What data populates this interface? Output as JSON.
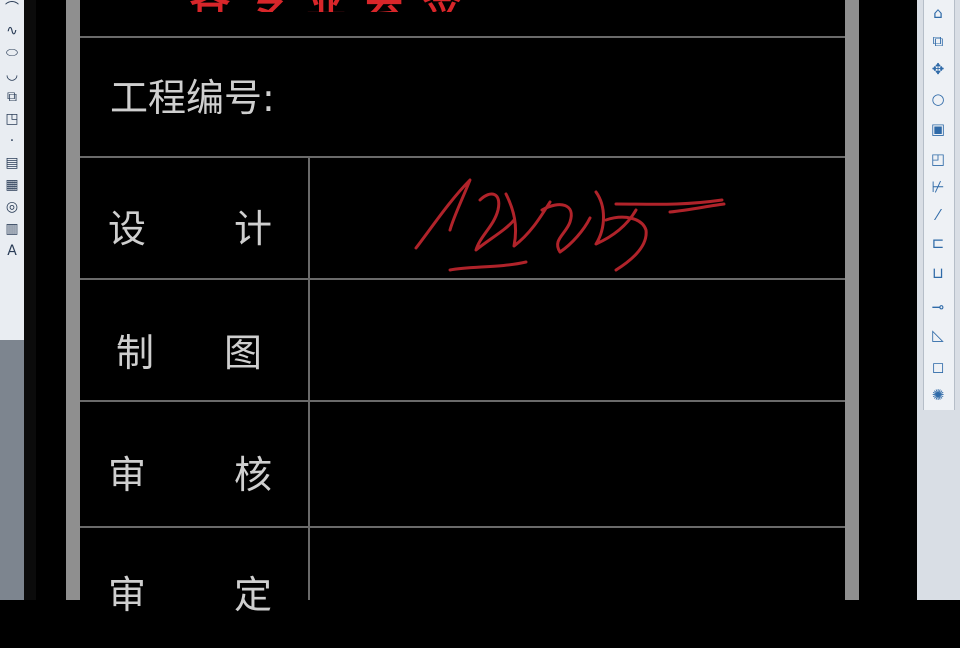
{
  "title_block": {
    "header": "各专业会签",
    "project_number_label": "工程编号:",
    "rows": [
      {
        "c1": "设",
        "c2": "计"
      },
      {
        "c1": "制",
        "c2": "图"
      },
      {
        "c1": "审",
        "c2": "核"
      },
      {
        "c1": "审",
        "c2": "定"
      }
    ]
  },
  "colors": {
    "table_line": "#6a6a6a",
    "text": "#cfcfcf",
    "header_red": "#d8262a",
    "signature_red": "#b0232a"
  },
  "left_toolbar_icons": [
    "arc-icon",
    "spline-icon",
    "ellipse-icon",
    "ellipse-arc-icon",
    "insert-block-icon",
    "make-block-icon",
    "point-icon",
    "hatch-icon",
    "gradient-icon",
    "region-icon",
    "table-icon",
    "multiline-text-icon"
  ],
  "right_toolbar_icons": [
    "erase-icon",
    "copy-icon",
    "mirror-icon",
    "offset-icon",
    "array-icon",
    "move-icon",
    "rotate-icon",
    "scale-icon",
    "stretch-icon",
    "trim-icon",
    "extend-icon",
    "break-icon",
    "join-icon",
    "chamfer-icon",
    "fillet-icon",
    "explode-icon"
  ]
}
